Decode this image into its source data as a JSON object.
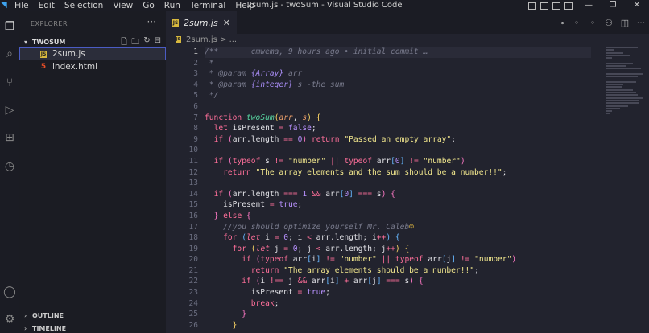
{
  "menu": [
    "File",
    "Edit",
    "Selection",
    "View",
    "Go",
    "Run",
    "Terminal",
    "Help"
  ],
  "window_title": "2sum.js - twoSum - Visual Studio Code",
  "sidebar": {
    "header": "EXPLORER",
    "section": "TWOSUM",
    "files": [
      {
        "name": "2sum.js",
        "type": "js"
      },
      {
        "name": "index.html",
        "type": "html"
      }
    ],
    "icon_js": "JS",
    "icon_html": "5",
    "outline": "OUTLINE",
    "timeline": "TIMELINE"
  },
  "tab": {
    "name": "2sum.js",
    "close": "✕"
  },
  "breadcrumb": {
    "file": "2sum.js",
    "sep": "> ..."
  },
  "editor": {
    "current_line": 1,
    "line_count": 26
  },
  "colors": {
    "accent": "#4b5cc4",
    "js_icon": "#d7b83e",
    "html_icon": "#e44d26"
  }
}
